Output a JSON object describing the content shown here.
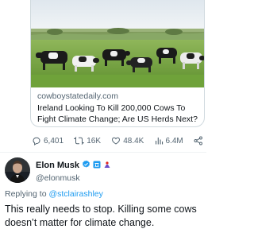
{
  "link_card": {
    "domain": "cowboystatedaily.com",
    "title": "Ireland Looking To Kill 200,000 Cows To Fight Climate Change; Are US Herds Next?",
    "image": "photo-cows-grazing-in-field"
  },
  "metrics": {
    "replies": "6,401",
    "reposts": "16K",
    "likes": "48.4K",
    "views": "6.4M"
  },
  "reply": {
    "display_name": "Elon Musk",
    "handle": "@elonmusk",
    "replying_prefix": "Replying to",
    "replying_to": "@stclairashley",
    "text": "This really needs to stop. Killing some cows doesn’t matter for climate change."
  },
  "colors": {
    "text": "#0f1419",
    "muted": "#536471",
    "link": "#1d9bf0",
    "border": "#cfd9de"
  }
}
